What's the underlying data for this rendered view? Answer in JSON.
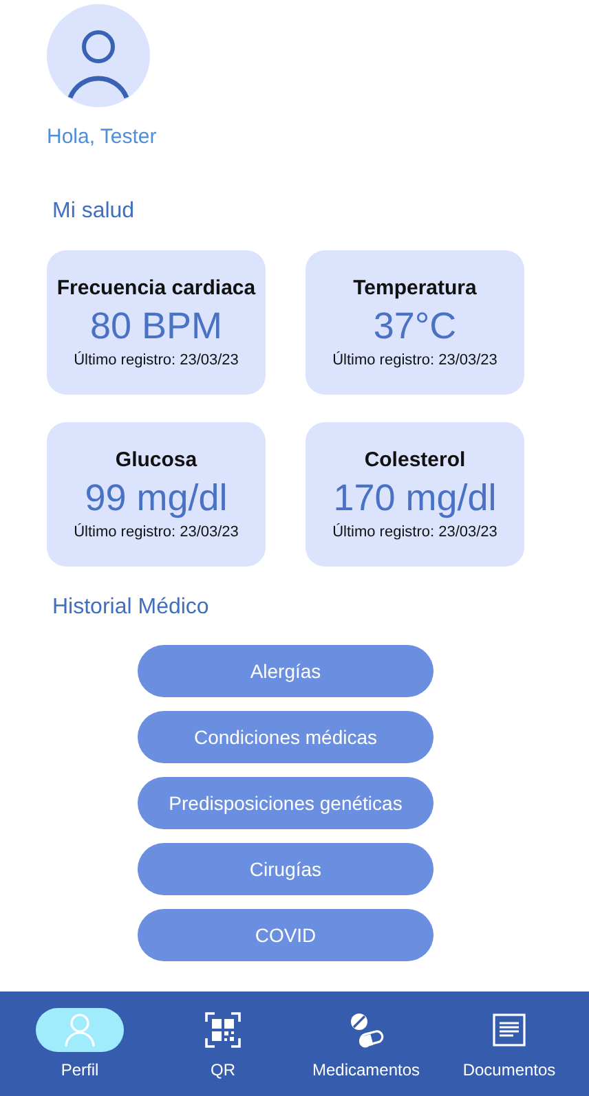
{
  "greeting": "Hola, Tester",
  "health": {
    "title": "Mi salud",
    "cards": [
      {
        "label": "Frecuencia cardiaca",
        "value": "80 BPM",
        "note": "Último registro: 23/03/23"
      },
      {
        "label": "Temperatura",
        "value": "37°C",
        "note": "Último registro: 23/03/23"
      },
      {
        "label": "Glucosa",
        "value": "99 mg/dl",
        "note": "Último registro: 23/03/23"
      },
      {
        "label": "Colesterol",
        "value": "170 mg/dl",
        "note": "Último registro: 23/03/23"
      }
    ]
  },
  "history": {
    "title": "Historial Médico",
    "buttons": [
      "Alergías",
      "Condiciones médicas",
      "Predisposiciones genéticas",
      "Cirugías",
      "COVID"
    ]
  },
  "nav": [
    {
      "kind": "person",
      "label": "Perfil",
      "selected": true
    },
    {
      "kind": "qr",
      "label": "QR",
      "selected": false
    },
    {
      "kind": "pills",
      "label": "Medicamentos",
      "selected": false
    },
    {
      "kind": "document",
      "label": "Documentos",
      "selected": false
    }
  ]
}
